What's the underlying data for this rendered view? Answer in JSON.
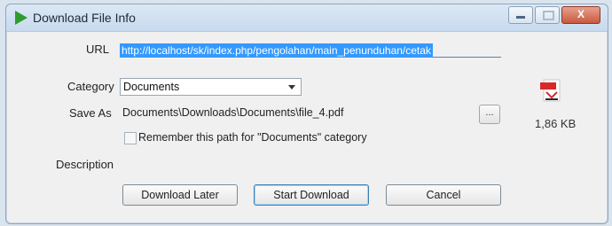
{
  "window": {
    "title": "Download File Info",
    "accent_color": "#3399ff"
  },
  "titlebar": {
    "minimize_label": "",
    "maximize_label": "",
    "close_label": "X"
  },
  "form": {
    "url_label": "URL",
    "url_value": "http://localhost/sk/index.php/pengolahan/main_penunduhan/cetak",
    "category_label": "Category",
    "category_value": "Documents",
    "save_as_label": "Save As",
    "save_as_value": "Documents\\Downloads\\Documents\\file_4.pdf",
    "browse_label": "...",
    "remember_label": "Remember this path for \"Documents\" category",
    "remember_checked": false,
    "description_label": "Description"
  },
  "file_info": {
    "icon": "pdf-file-icon",
    "size": "1,86 KB"
  },
  "buttons": {
    "download_later": "Download Later",
    "start_download": "Start Download",
    "cancel": "Cancel"
  }
}
